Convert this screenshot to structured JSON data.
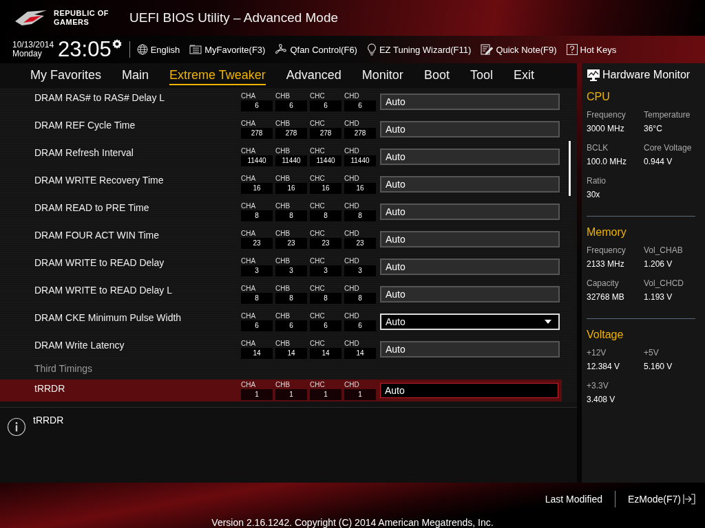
{
  "header": {
    "brand": [
      "REPUBLIC OF",
      "GAMERS"
    ],
    "title": "UEFI BIOS Utility – Advanced Mode"
  },
  "clock": {
    "date": "10/13/2014",
    "day": "Monday",
    "time": "23:05"
  },
  "toolbar": [
    {
      "kind": "globe",
      "label": "English"
    },
    {
      "kind": "favorite",
      "label": "MyFavorite(F3)"
    },
    {
      "kind": "fan",
      "label": "Qfan Control(F6)"
    },
    {
      "kind": "bulb",
      "label": "EZ Tuning Wizard(F11)"
    },
    {
      "kind": "note",
      "label": "Quick Note(F9)"
    },
    {
      "kind": "help",
      "label": "Hot Keys"
    }
  ],
  "tabs": [
    {
      "label": "My Favorites",
      "selected": false
    },
    {
      "label": "Main",
      "selected": false
    },
    {
      "label": "Extreme Tweaker",
      "selected": true
    },
    {
      "label": "Advanced",
      "selected": false
    },
    {
      "label": "Monitor",
      "selected": false
    },
    {
      "label": "Boot",
      "selected": false
    },
    {
      "label": "Tool",
      "selected": false
    },
    {
      "label": "Exit",
      "selected": false
    }
  ],
  "settings": [
    {
      "kind": "setting",
      "label": "DRAM RAS# to RAS# Delay L",
      "channels": [
        {
          "name": "CHA",
          "value": "6"
        },
        {
          "name": "CHB",
          "value": "6"
        },
        {
          "name": "CHC",
          "value": "6"
        },
        {
          "name": "CHD",
          "value": "6"
        }
      ],
      "value": "Auto",
      "selected": false,
      "focused": false
    },
    {
      "kind": "setting",
      "label": "DRAM REF Cycle Time",
      "channels": [
        {
          "name": "CHA",
          "value": "278"
        },
        {
          "name": "CHB",
          "value": "278"
        },
        {
          "name": "CHC",
          "value": "278"
        },
        {
          "name": "CHD",
          "value": "278"
        }
      ],
      "value": "Auto",
      "selected": false,
      "focused": false
    },
    {
      "kind": "setting",
      "label": "DRAM Refresh Interval",
      "channels": [
        {
          "name": "CHA",
          "value": "11440"
        },
        {
          "name": "CHB",
          "value": "11440"
        },
        {
          "name": "CHC",
          "value": "11440"
        },
        {
          "name": "CHD",
          "value": "11440"
        }
      ],
      "value": "Auto",
      "selected": false,
      "focused": false
    },
    {
      "kind": "setting",
      "label": "DRAM WRITE Recovery Time",
      "channels": [
        {
          "name": "CHA",
          "value": "16"
        },
        {
          "name": "CHB",
          "value": "16"
        },
        {
          "name": "CHC",
          "value": "16"
        },
        {
          "name": "CHD",
          "value": "16"
        }
      ],
      "value": "Auto",
      "selected": false,
      "focused": false
    },
    {
      "kind": "setting",
      "label": "DRAM READ to PRE Time",
      "channels": [
        {
          "name": "CHA",
          "value": "8"
        },
        {
          "name": "CHB",
          "value": "8"
        },
        {
          "name": "CHC",
          "value": "8"
        },
        {
          "name": "CHD",
          "value": "8"
        }
      ],
      "value": "Auto",
      "selected": false,
      "focused": false
    },
    {
      "kind": "setting",
      "label": "DRAM FOUR ACT WIN Time",
      "channels": [
        {
          "name": "CHA",
          "value": "23"
        },
        {
          "name": "CHB",
          "value": "23"
        },
        {
          "name": "CHC",
          "value": "23"
        },
        {
          "name": "CHD",
          "value": "23"
        }
      ],
      "value": "Auto",
      "selected": false,
      "focused": false
    },
    {
      "kind": "setting",
      "label": "DRAM WRITE to READ Delay",
      "channels": [
        {
          "name": "CHA",
          "value": "3"
        },
        {
          "name": "CHB",
          "value": "3"
        },
        {
          "name": "CHC",
          "value": "3"
        },
        {
          "name": "CHD",
          "value": "3"
        }
      ],
      "value": "Auto",
      "selected": false,
      "focused": false
    },
    {
      "kind": "setting",
      "label": "DRAM WRITE to READ Delay L",
      "channels": [
        {
          "name": "CHA",
          "value": "8"
        },
        {
          "name": "CHB",
          "value": "8"
        },
        {
          "name": "CHC",
          "value": "8"
        },
        {
          "name": "CHD",
          "value": "8"
        }
      ],
      "value": "Auto",
      "selected": false,
      "focused": false
    },
    {
      "kind": "setting",
      "label": "DRAM CKE Minimum Pulse Width",
      "channels": [
        {
          "name": "CHA",
          "value": "6"
        },
        {
          "name": "CHB",
          "value": "6"
        },
        {
          "name": "CHC",
          "value": "6"
        },
        {
          "name": "CHD",
          "value": "6"
        }
      ],
      "value": "Auto",
      "selected": false,
      "focused": true
    },
    {
      "kind": "setting",
      "label": "DRAM Write Latency",
      "channels": [
        {
          "name": "CHA",
          "value": "14"
        },
        {
          "name": "CHB",
          "value": "14"
        },
        {
          "name": "CHC",
          "value": "14"
        },
        {
          "name": "CHD",
          "value": "14"
        }
      ],
      "value": "Auto",
      "selected": false,
      "focused": false
    },
    {
      "kind": "heading",
      "label": "Third Timings"
    },
    {
      "kind": "setting",
      "label": "tRRDR",
      "channels": [
        {
          "name": "CHA",
          "value": "1"
        },
        {
          "name": "CHB",
          "value": "1"
        },
        {
          "name": "CHC",
          "value": "1"
        },
        {
          "name": "CHD",
          "value": "1"
        }
      ],
      "value": "Auto",
      "selected": true,
      "focused": false
    }
  ],
  "help": {
    "text": "tRRDR"
  },
  "hardware_monitor": {
    "title": "Hardware Monitor",
    "sections": [
      {
        "title": "CPU",
        "items": [
          {
            "label": "Frequency",
            "value": "3000 MHz"
          },
          {
            "label": "Temperature",
            "value": "36°C"
          },
          {
            "label": "BCLK",
            "value": "100.0 MHz"
          },
          {
            "label": "Core Voltage",
            "value": "0.944 V"
          },
          {
            "label": "Ratio",
            "value": "30x"
          }
        ]
      },
      {
        "title": "Memory",
        "items": [
          {
            "label": "Frequency",
            "value": "2133 MHz"
          },
          {
            "label": "Vol_CHAB",
            "value": "1.206 V"
          },
          {
            "label": "Capacity",
            "value": "32768 MB"
          },
          {
            "label": "Vol_CHCD",
            "value": "1.193 V"
          }
        ]
      },
      {
        "title": "Voltage",
        "items": [
          {
            "label": "+12V",
            "value": "12.384 V"
          },
          {
            "label": "+5V",
            "value": "5.160 V"
          },
          {
            "label": "+3.3V",
            "value": "3.408 V"
          }
        ]
      }
    ]
  },
  "footer": {
    "last_modified": "Last Modified",
    "ez_mode": "EzMode(F7)",
    "version": "Version 2.16.1242. Copyright (C) 2014 American Megatrends, Inc."
  }
}
